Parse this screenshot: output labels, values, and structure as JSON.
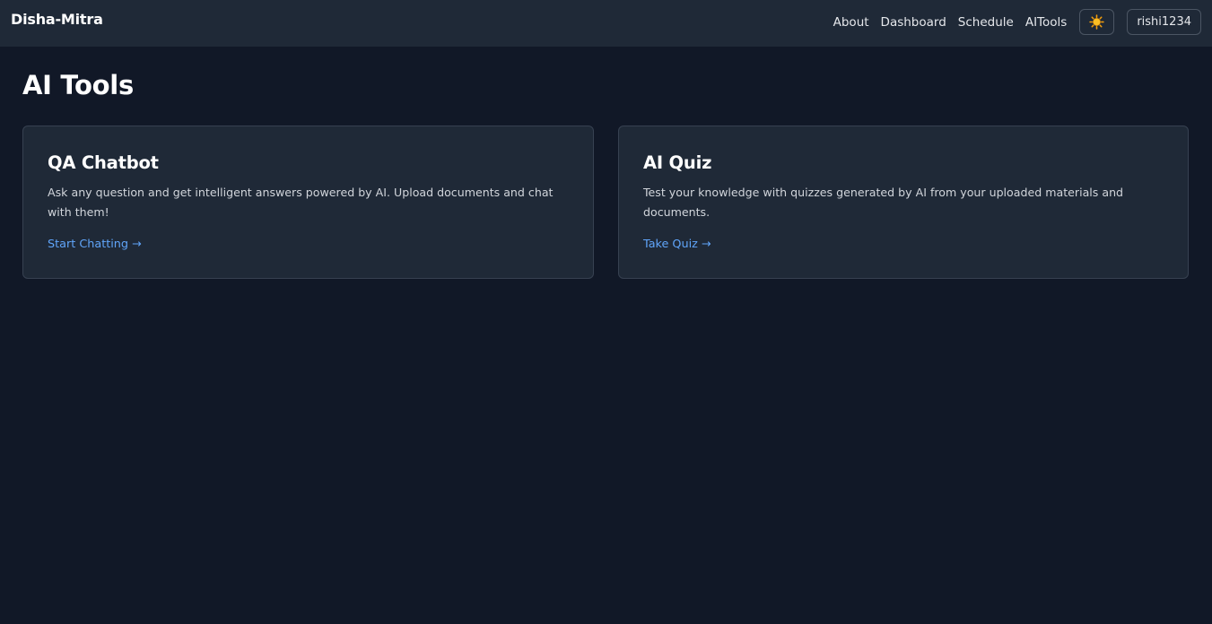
{
  "navbar": {
    "brand": "Disha-Mitra",
    "links": [
      "About",
      "Dashboard",
      "Schedule",
      "AITools"
    ],
    "theme_icon": "sun-icon",
    "user": "rishi1234"
  },
  "page": {
    "title": "AI Tools"
  },
  "cards": [
    {
      "title": "QA Chatbot",
      "description": "Ask any question and get intelligent answers powered by AI. Upload documents and chat with them!",
      "link": "Start Chatting →"
    },
    {
      "title": "AI Quiz",
      "description": "Test your knowledge with quizzes generated by AI from your uploaded materials and documents.",
      "link": "Take Quiz →"
    }
  ],
  "colors": {
    "background": "#111827",
    "surface": "#1f2937",
    "border": "#374151",
    "accent_link": "#60a5fa"
  }
}
